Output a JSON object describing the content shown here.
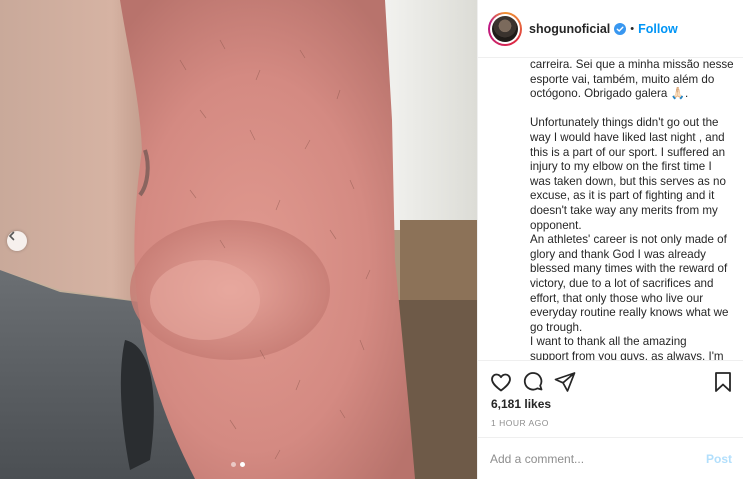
{
  "post": {
    "username": "shogunoficial",
    "follow_label": "Follow",
    "separator": "•",
    "caption_lines_pt": "carreira. Sei que a minha missão nesse\nesporte vai, também, muito além do\noctógono. Obrigado galera 🙏🏻.",
    "caption_lines_en_1": "Unfortunately things didn't go out the\nway I would have liked last night , and\nthis is a part of our sport. I suffered an\ninjury to my elbow on the first time I\nwas taken down, but this serves as no\nexcuse, as it is part of fighting and it\ndoesn't take way any merits from my\nopponent.",
    "caption_lines_en_2": "An athletes' career is not only made of\nglory and thank God I was already\nblessed many times with the reward of\nvictory, due to a lot of sacrifices and\neffort, that only those who live our\neveryday routine really knows what we\ngo trough.",
    "caption_lines_en_3": "I want to thank all the amazing\nsupport from you guys, as always. I'm",
    "likes": "6,181 likes",
    "time": "1 HOUR AGO",
    "comment_placeholder": "Add a comment...",
    "post_label": "Post"
  },
  "carousel": {
    "slides": 2,
    "active_index": 1
  },
  "icons": {
    "prev": "chevron-left-icon",
    "verified": "verified-badge-icon",
    "like": "heart-icon",
    "comment": "comment-icon",
    "share": "paper-plane-icon",
    "save": "bookmark-icon"
  },
  "colors": {
    "accent": "#0095f6",
    "verified": "#3897f0",
    "muted": "#8e8e8e",
    "post_disabled": "#b2dffc"
  }
}
